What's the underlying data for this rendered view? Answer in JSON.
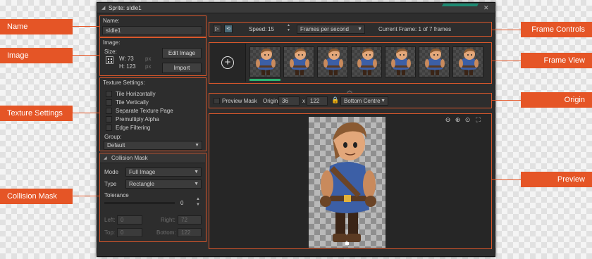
{
  "window": {
    "title": "Sprite: sIdle1"
  },
  "name_section": {
    "label": "Name:",
    "value": "sIdle1"
  },
  "image_section": {
    "label": "Image:",
    "size_label": "Size:",
    "width_label": "W: 73",
    "height_label": "H: 123",
    "unit": "px",
    "edit_button": "Edit Image",
    "import_button": "Import"
  },
  "texture_settings": {
    "label": "Texture Settings:",
    "options": [
      "Tile Horizontally",
      "Tile Vertically",
      "Separate Texture Page",
      "Premultiply Alpha",
      "Edge Filtering"
    ],
    "group_label": "Group:",
    "group_value": "Default"
  },
  "collision_mask": {
    "header": "Collision Mask",
    "mode_label": "Mode",
    "mode_value": "Full Image",
    "type_label": "Type",
    "type_value": "Rectangle",
    "tolerance_label": "Tolerance",
    "tolerance_value": "0",
    "left_label": "Left:",
    "left_value": "0",
    "right_label": "Right:",
    "right_value": "72",
    "top_label": "Top:",
    "top_value": "0",
    "bottom_label": "Bottom:",
    "bottom_value": "122"
  },
  "frame_controls": {
    "speed_label": "Speed:",
    "speed_value": "15",
    "speed_units": "Frames per second",
    "current_frame": "Current Frame: 1 of 7 frames"
  },
  "frames": {
    "count": 7,
    "selected_index": 0
  },
  "origin_bar": {
    "preview_mask_label": "Preview Mask",
    "origin_label": "Origin:",
    "origin_x": "36",
    "x_sep": "x",
    "origin_y": "122",
    "origin_preset": "Bottom Centre"
  },
  "callouts": {
    "name": "Name",
    "image": "Image",
    "texture_settings": "Texture Settings",
    "collision_mask": "Collision Mask",
    "frame_controls": "Frame Controls",
    "frame_view": "Frame View",
    "origin": "Origin",
    "preview": "Preview"
  },
  "colors": {
    "accent": "#e55526",
    "panel": "#2d2d2d",
    "selection": "#2bb673"
  }
}
